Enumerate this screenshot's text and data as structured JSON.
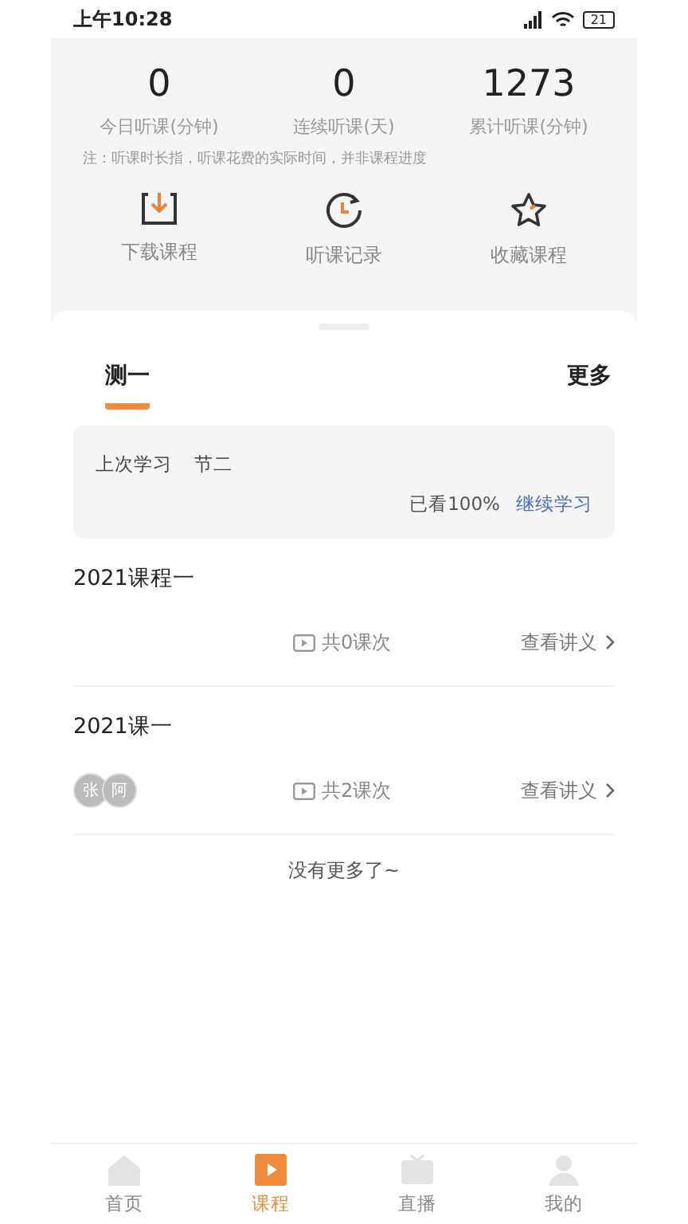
{
  "status_bar": {
    "time": "上午10:28",
    "battery": "21"
  },
  "stats": [
    {
      "value": "0",
      "label": "今日听课(分钟)"
    },
    {
      "value": "0",
      "label": "连续听课(天)"
    },
    {
      "value": "1273",
      "label": "累计听课(分钟)"
    }
  ],
  "note": "注：听课时长指，听课花费的实际时间，并非课程进度",
  "shortcuts": [
    {
      "kind": "download",
      "label": "下载课程"
    },
    {
      "kind": "history",
      "label": "听课记录"
    },
    {
      "kind": "favorite",
      "label": "收藏课程"
    }
  ],
  "tabs": [
    {
      "label": "测一",
      "selected": true
    }
  ],
  "more": "更多",
  "last_study": {
    "label": "上次学习",
    "lesson": "节二",
    "progress": "已看100%",
    "action": "继续学习"
  },
  "courses": [
    {
      "title": "2021课程一",
      "lessons": "共0课次",
      "notes_link": "查看讲义"
    },
    {
      "title": "2021课一",
      "teachers": [
        "张",
        "阿"
      ],
      "lessons": "共2课次",
      "notes_link": "查看讲义"
    }
  ],
  "end_text": "没有更多了~",
  "nav": [
    {
      "kind": "home",
      "label": "首页",
      "selected": false
    },
    {
      "kind": "course",
      "label": "课程",
      "selected": true
    },
    {
      "kind": "live",
      "label": "直播",
      "selected": false
    },
    {
      "kind": "me",
      "label": "我的",
      "selected": false
    }
  ]
}
